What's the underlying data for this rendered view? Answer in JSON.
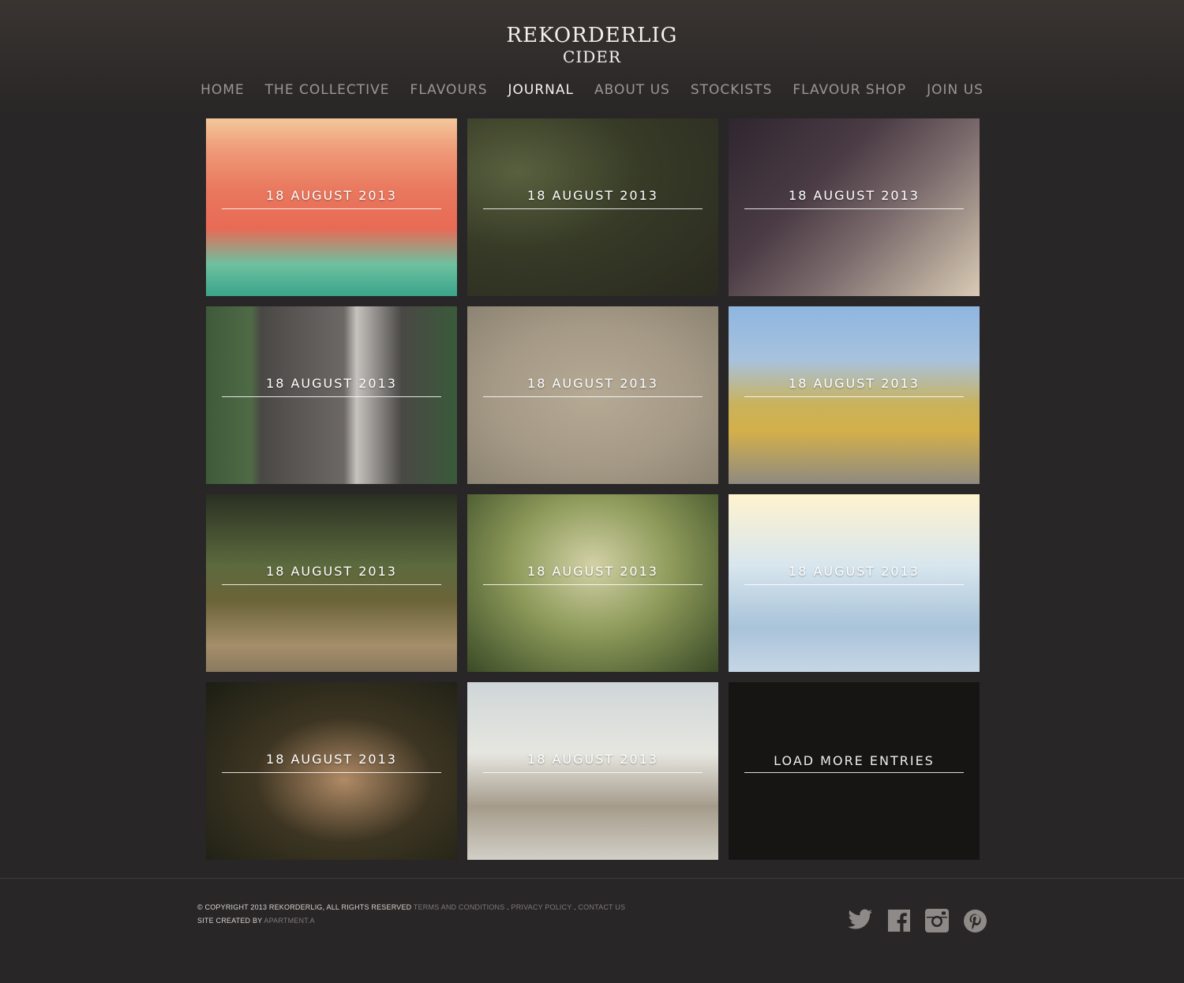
{
  "brand": {
    "line1": "REKORDERLIG",
    "line2": "CIDER"
  },
  "nav": [
    {
      "label": "HOME"
    },
    {
      "label": "THE COLLECTIVE"
    },
    {
      "label": "FLAVOURS"
    },
    {
      "label": "JOURNAL",
      "active": true
    },
    {
      "label": "ABOUT US"
    },
    {
      "label": "STOCKISTS"
    },
    {
      "label": "FLAVOUR SHOP"
    },
    {
      "label": "JOIN US"
    }
  ],
  "entries": [
    {
      "date": "18 AUGUST 2013"
    },
    {
      "date": "18 AUGUST 2013"
    },
    {
      "date": "18 AUGUST 2013"
    },
    {
      "date": "18 AUGUST 2013"
    },
    {
      "date": "18 AUGUST 2013"
    },
    {
      "date": "18 AUGUST 2013"
    },
    {
      "date": "18 AUGUST 2013"
    },
    {
      "date": "18 AUGUST 2013"
    },
    {
      "date": "18 AUGUST 2013"
    },
    {
      "date": "18 AUGUST 2013"
    },
    {
      "date": "18 AUGUST 2013"
    }
  ],
  "load_more": "LOAD MORE ENTRIES",
  "footer": {
    "copyright": "© COPYRIGHT 2013 REKORDERLIG, ALL RIGHTS RESERVED",
    "terms": "TERMS AND CONDITIONS",
    "sep1": ".",
    "privacy": "PRIVACY POLICY",
    "sep2": ".",
    "contact": "CONTACT US",
    "created_by": "SITE CREATED BY",
    "agency": "APARTMENT.A"
  },
  "social_icons": [
    "twitter-icon",
    "facebook-icon",
    "instagram-icon",
    "pinterest-icon"
  ]
}
